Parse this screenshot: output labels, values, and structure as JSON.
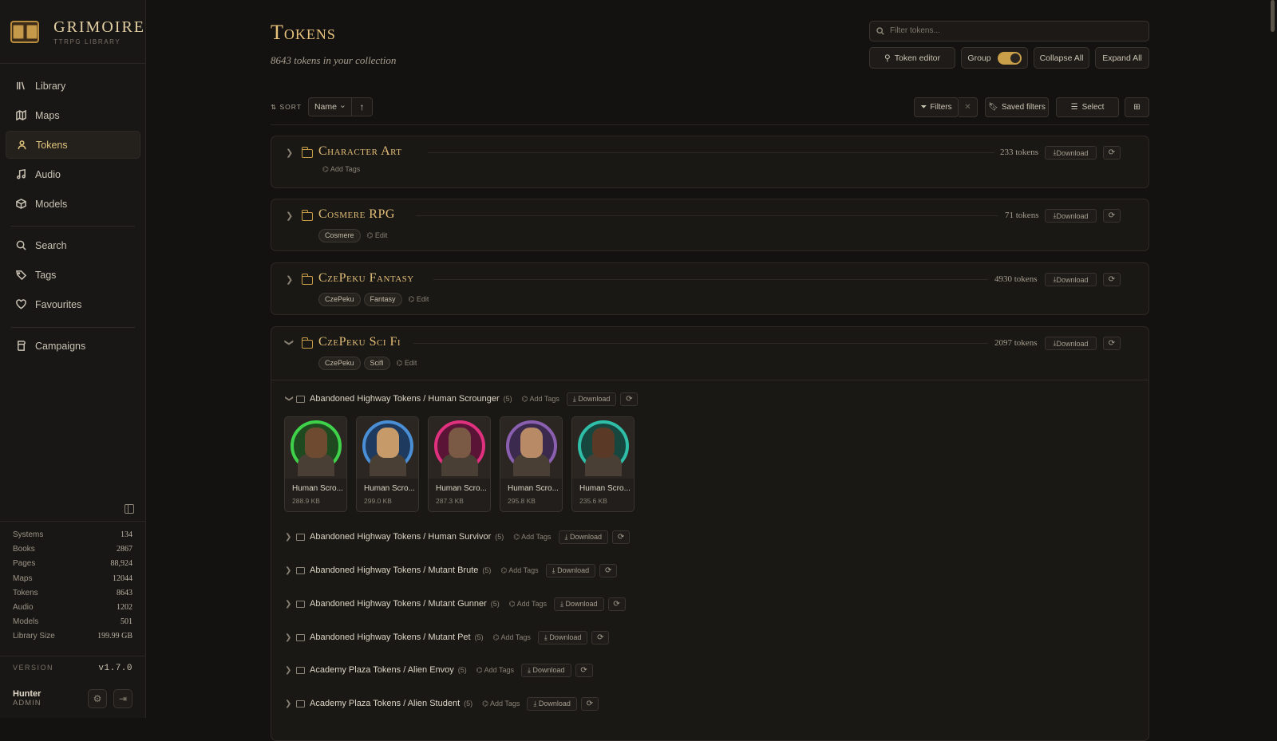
{
  "brand": {
    "title": "GRIMOIRE",
    "subtitle": "TTRPG LIBRARY"
  },
  "nav": {
    "items": [
      {
        "label": "Library",
        "icon": "library-icon"
      },
      {
        "label": "Maps",
        "icon": "map-icon"
      },
      {
        "label": "Tokens",
        "icon": "user-icon"
      },
      {
        "label": "Audio",
        "icon": "music-icon"
      },
      {
        "label": "Models",
        "icon": "cube-icon"
      }
    ],
    "items2": [
      {
        "label": "Search",
        "icon": "search-icon"
      },
      {
        "label": "Tags",
        "icon": "tags-icon"
      },
      {
        "label": "Favourites",
        "icon": "heart-icon"
      }
    ],
    "items3": [
      {
        "label": "Campaigns",
        "icon": "campaign-icon"
      }
    ]
  },
  "stats": [
    {
      "label": "Systems",
      "value": "134"
    },
    {
      "label": "Books",
      "value": "2867"
    },
    {
      "label": "Pages",
      "value": "88,924"
    },
    {
      "label": "Maps",
      "value": "12044"
    },
    {
      "label": "Tokens",
      "value": "8643"
    },
    {
      "label": "Audio",
      "value": "1202"
    },
    {
      "label": "Models",
      "value": "501"
    },
    {
      "label": "Library Size",
      "value": "199.99 GB"
    }
  ],
  "version": {
    "label": "VERSION",
    "value": "v1.7.0"
  },
  "user": {
    "name": "Hunter",
    "role": "ADMIN"
  },
  "header": {
    "title": "Tokens",
    "subtitle": "8643 tokens in your collection",
    "filter_placeholder": "Filter tokens...",
    "token_editor": "Token editor",
    "group": "Group",
    "collapse_all": "Collapse All",
    "expand_all": "Expand All"
  },
  "sort": {
    "label": "SORT",
    "value": "Name"
  },
  "toolbar": {
    "filters": "Filters",
    "saved_filters": "Saved filters",
    "select": "Select"
  },
  "groups": [
    {
      "name": "Character Art",
      "count": "233 tokens",
      "tags": [],
      "tag_action": "Add Tags",
      "download": "Download"
    },
    {
      "name": "Cosmere RPG",
      "count": "71 tokens",
      "tags": [
        "Cosmere"
      ],
      "tag_action": "Edit",
      "download": "Download"
    },
    {
      "name": "CzePeku Fantasy",
      "count": "4930 tokens",
      "tags": [
        "CzePeku",
        "Fantasy"
      ],
      "tag_action": "Edit",
      "download": "Download"
    },
    {
      "name": "CzePeku Sci Fi",
      "count": "2097 tokens",
      "tags": [
        "CzePeku",
        "Scifi"
      ],
      "tag_action": "Edit",
      "download": "Download"
    }
  ],
  "subgroups": [
    {
      "name": "Abandoned Highway Tokens / Human Scrounger",
      "count": "(5)",
      "add_tags": "Add Tags",
      "download": "Download"
    },
    {
      "name": "Abandoned Highway Tokens / Human Survivor",
      "count": "(5)",
      "add_tags": "Add Tags",
      "download": "Download"
    },
    {
      "name": "Abandoned Highway Tokens / Mutant Brute",
      "count": "(5)",
      "add_tags": "Add Tags",
      "download": "Download"
    },
    {
      "name": "Abandoned Highway Tokens / Mutant Gunner",
      "count": "(5)",
      "add_tags": "Add Tags",
      "download": "Download"
    },
    {
      "name": "Abandoned Highway Tokens / Mutant Pet",
      "count": "(5)",
      "add_tags": "Add Tags",
      "download": "Download"
    },
    {
      "name": "Academy Plaza Tokens / Alien Envoy",
      "count": "(5)",
      "add_tags": "Add Tags",
      "download": "Download"
    },
    {
      "name": "Academy Plaza Tokens / Alien Student",
      "count": "(5)",
      "add_tags": "Add Tags",
      "download": "Download"
    }
  ],
  "tokens": [
    {
      "name": "Human Scro...",
      "size": "288.9 KB",
      "ring": "#3fd14a",
      "skin": "#6e4a30"
    },
    {
      "name": "Human Scro...",
      "size": "299.0 KB",
      "ring": "#4a8fd6",
      "skin": "#c79a6a"
    },
    {
      "name": "Human Scro...",
      "size": "287.3 KB",
      "ring": "#e0317f",
      "skin": "#7a5a45"
    },
    {
      "name": "Human Scro...",
      "size": "295.8 KB",
      "ring": "#8a5fb0",
      "skin": "#b88a66"
    },
    {
      "name": "Human Scro...",
      "size": "235.6 KB",
      "ring": "#2fbfa8",
      "skin": "#5a3a26"
    }
  ],
  "colors": {
    "accent": "#e2bd77",
    "bg": "#141210",
    "sidebar": "#191715",
    "toggle": "#c9a049"
  }
}
